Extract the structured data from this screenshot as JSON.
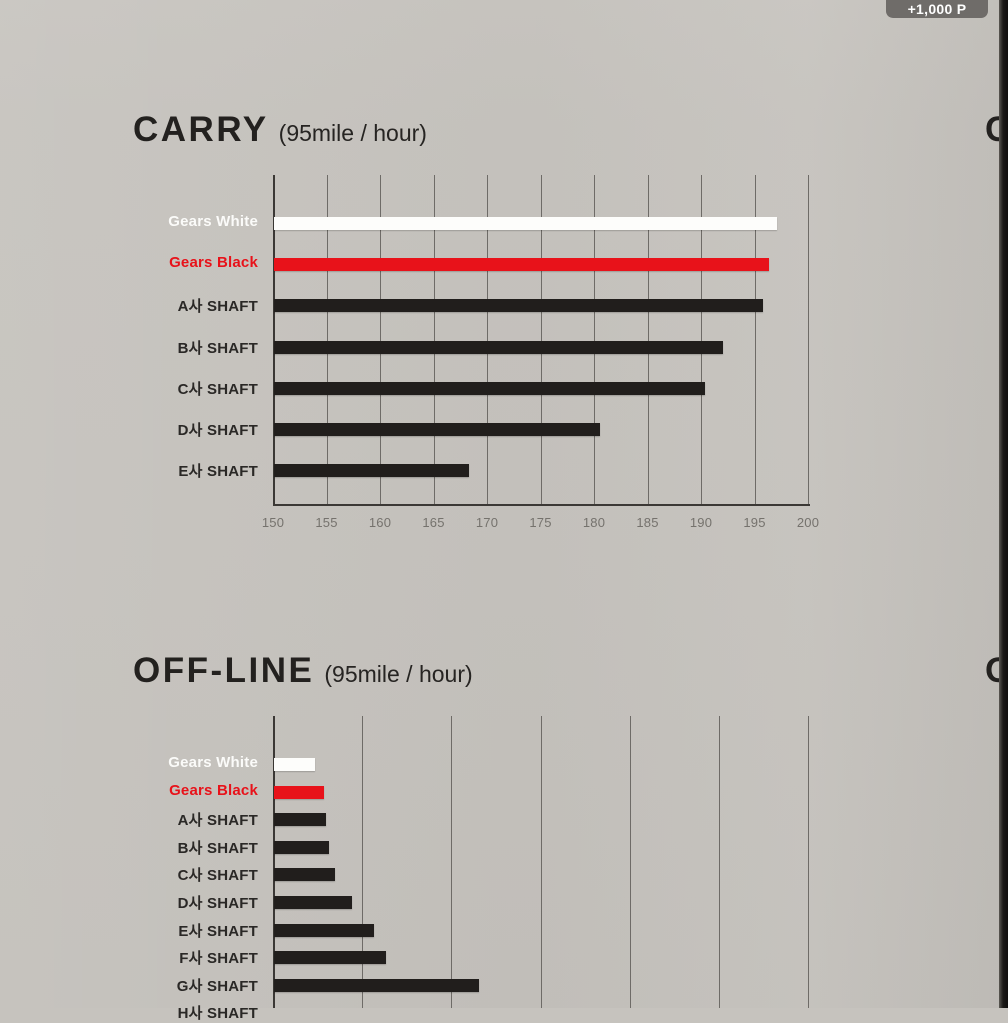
{
  "badge": {
    "label": "+1,000 P"
  },
  "colors": {
    "background": "#c5c2bd",
    "bar_dark": "#211e1c",
    "bar_red": "#e8121a",
    "bar_white": "#fdfdfb",
    "grid": "#6e6b67",
    "axis": "#3b3835",
    "title": "#23211f"
  },
  "charts": [
    {
      "title_main": "CARRY",
      "title_sub": "(95mile / hour)",
      "edge_letter": "C",
      "axis_ticks": [
        "150",
        "155",
        "160",
        "165",
        "170",
        "175",
        "180",
        "185",
        "190",
        "195",
        "200"
      ],
      "rows": [
        {
          "label": "Gears White",
          "value": 197.0,
          "style": "white"
        },
        {
          "label": "Gears Black",
          "value": 196.3,
          "style": "red"
        },
        {
          "label": "A사 SHAFT",
          "value": 195.7,
          "style": "dark"
        },
        {
          "label": "B사 SHAFT",
          "value": 192.0,
          "style": "dark"
        },
        {
          "label": "C사 SHAFT",
          "value": 190.3,
          "style": "dark"
        },
        {
          "label": "D사 SHAFT",
          "value": 180.5,
          "style": "dark"
        },
        {
          "label": "E사 SHAFT",
          "value": 168.2,
          "style": "dark"
        }
      ]
    },
    {
      "title_main": "OFF-LINE",
      "title_sub": "(95mile / hour)",
      "edge_letter": "O",
      "axis_ticks": [],
      "rows": [
        {
          "label": "Gears White",
          "value": 17.3,
          "style": "white"
        },
        {
          "label": "Gears Black",
          "value": 17.8,
          "style": "red"
        },
        {
          "label": "A사 SHAFT",
          "value": 17.9,
          "style": "dark"
        },
        {
          "label": "B사 SHAFT",
          "value": 18.1,
          "style": "dark"
        },
        {
          "label": "C사 SHAFT",
          "value": 18.4,
          "style": "dark"
        },
        {
          "label": "D사 SHAFT",
          "value": 19.4,
          "style": "dark"
        },
        {
          "label": "E사 SHAFT",
          "value": 20.6,
          "style": "dark"
        },
        {
          "label": "F사 SHAFT",
          "value": 21.3,
          "style": "dark"
        },
        {
          "label": "G사 SHAFT",
          "value": 26.5,
          "style": "dark"
        },
        {
          "label": "H사 SHAFT",
          "value": 0,
          "style": "dark"
        }
      ]
    }
  ],
  "chart_data": [
    {
      "type": "bar",
      "orientation": "horizontal",
      "title": "CARRY (95mile / hour)",
      "xlabel": "",
      "ylabel": "",
      "xlim": [
        150,
        200
      ],
      "xticks": [
        150,
        155,
        160,
        165,
        170,
        175,
        180,
        185,
        190,
        195,
        200
      ],
      "grid": true,
      "legend": "none",
      "categories": [
        "Gears White",
        "Gears Black",
        "A사 SHAFT",
        "B사 SHAFT",
        "C사 SHAFT",
        "D사 SHAFT",
        "E사 SHAFT"
      ],
      "values": [
        197.0,
        196.3,
        195.7,
        192.0,
        190.3,
        180.5,
        168.2
      ],
      "colors": [
        "#fdfdfb",
        "#e8121a",
        "#211e1c",
        "#211e1c",
        "#211e1c",
        "#211e1c",
        "#211e1c"
      ]
    },
    {
      "type": "bar",
      "orientation": "horizontal",
      "title": "OFF-LINE (95mile / hour)",
      "xlabel": "",
      "ylabel": "",
      "xlim": [
        15,
        45
      ],
      "xticks": [
        15,
        20,
        25,
        30,
        35,
        40,
        45
      ],
      "grid": true,
      "legend": "none",
      "note": "bottom of chart is cropped by the screenshot; H사 SHAFT row only partially visible and x tick labels not visible",
      "categories": [
        "Gears White",
        "Gears Black",
        "A사 SHAFT",
        "B사 SHAFT",
        "C사 SHAFT",
        "D사 SHAFT",
        "E사 SHAFT",
        "F사 SHAFT",
        "G사 SHAFT"
      ],
      "values": [
        17.3,
        17.8,
        17.9,
        18.1,
        18.4,
        19.4,
        20.6,
        21.3,
        26.5
      ],
      "colors": [
        "#fdfdfb",
        "#e8121a",
        "#211e1c",
        "#211e1c",
        "#211e1c",
        "#211e1c",
        "#211e1c",
        "#211e1c",
        "#211e1c"
      ]
    }
  ]
}
